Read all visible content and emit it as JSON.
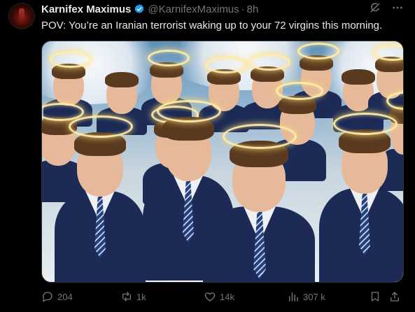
{
  "tweet": {
    "author_name": "Karnifex Maximus",
    "handle": "@KarnifexMaximus",
    "separator": "·",
    "time": "8h",
    "text": "POV: You’re an Iranian terrorist waking up to your 72 virgins this morning."
  },
  "icons": {
    "verified": "verified-badge-icon",
    "grok": "grok-icon",
    "more": "more-icon",
    "reply": "reply-icon",
    "retweet": "retweet-icon",
    "like": "heart-icon",
    "views": "views-icon",
    "bookmark": "bookmark-icon",
    "share": "share-icon"
  },
  "colors": {
    "background": "#000000",
    "text": "#e7e9ea",
    "muted": "#71767b",
    "verified": "#1d9bf0"
  },
  "actions": {
    "replies": "204",
    "reposts": "1k",
    "likes": "14k",
    "views": "307 k"
  }
}
